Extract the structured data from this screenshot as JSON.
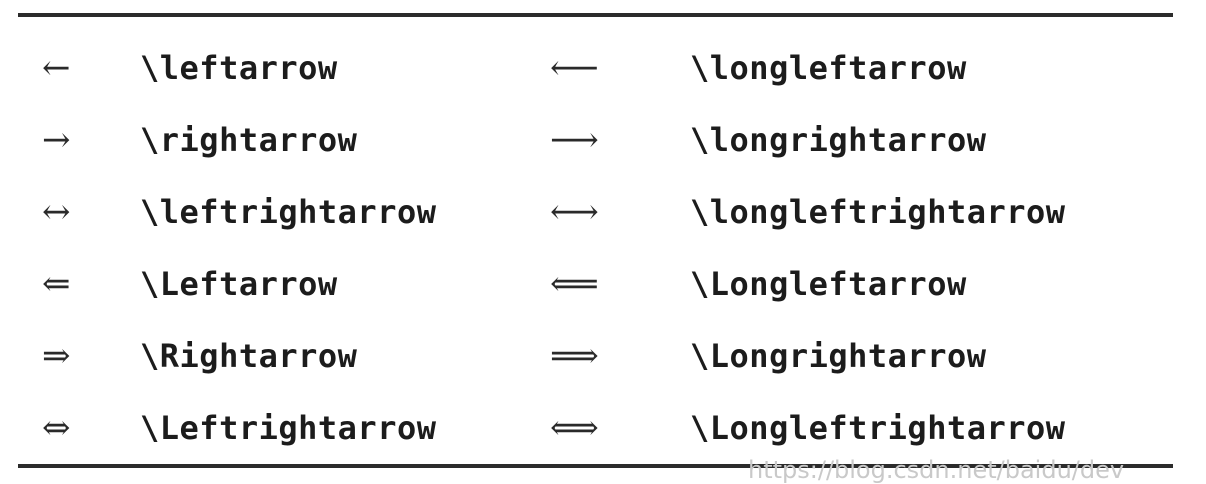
{
  "rows": [
    {
      "symbol": "←",
      "command": "\\leftarrow",
      "long_symbol": "⟵",
      "long_command": "\\longleftarrow"
    },
    {
      "symbol": "→",
      "command": "\\rightarrow",
      "long_symbol": "⟶",
      "long_command": "\\longrightarrow"
    },
    {
      "symbol": "↔",
      "command": "\\leftrightarrow",
      "long_symbol": "⟷",
      "long_command": "\\longleftrightarrow"
    },
    {
      "symbol": "⇐",
      "command": "\\Leftarrow",
      "long_symbol": "⟸",
      "long_command": "\\Longleftarrow"
    },
    {
      "symbol": "⇒",
      "command": "\\Rightarrow",
      "long_symbol": "⟹",
      "long_command": "\\Longrightarrow"
    },
    {
      "symbol": "⇔",
      "command": "\\Leftrightarrow",
      "long_symbol": "⟺",
      "long_command": "\\Longleftrightarrow"
    }
  ],
  "watermark": "https://blog.csdn.net/baidu/dev"
}
